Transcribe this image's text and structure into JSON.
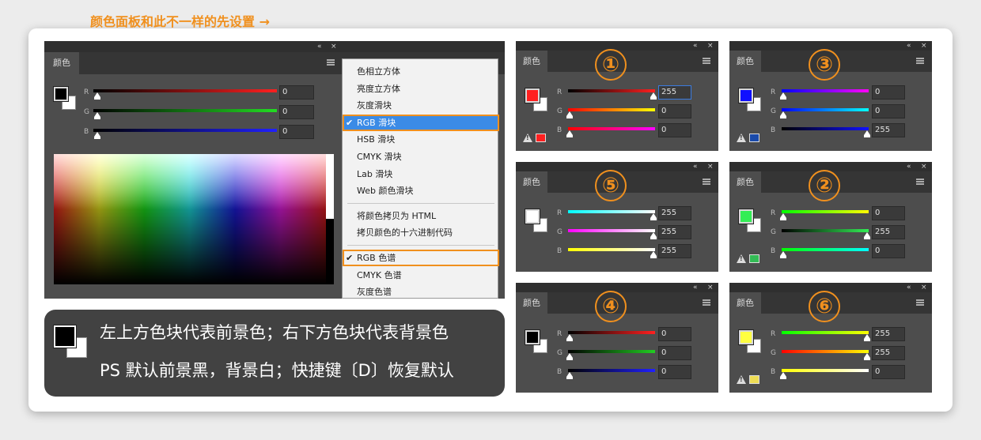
{
  "main_panel": {
    "tab": "颜色",
    "note": "颜色面板和此不一样的先设置 →",
    "collapse": "«",
    "close": "×",
    "fg_color": "#000000",
    "bg_color": "#ffffff",
    "channels": [
      {
        "label": "R",
        "value": "0"
      },
      {
        "label": "G",
        "value": "0"
      },
      {
        "label": "B",
        "value": "0"
      }
    ]
  },
  "menu": {
    "groups": [
      [
        "色相立方体",
        "亮度立方体",
        "灰度滑块",
        "RGB 滑块",
        "HSB 滑块",
        "CMYK 滑块",
        "Lab 滑块",
        "Web 颜色滑块"
      ],
      [
        "将颜色拷贝为 HTML",
        "拷贝颜色的十六进制代码"
      ],
      [
        "RGB 色谱",
        "CMYK 色谱",
        "灰度色谱"
      ]
    ],
    "checked": [
      "RGB 滑块",
      "RGB 色谱"
    ],
    "check_mark": "✔"
  },
  "info": {
    "line1": "左上方色块代表前景色；右下方色块代表背景色",
    "line2": "PS 默认前景黑，背景白；快捷键〔D〕恢复默认"
  },
  "examples": [
    {
      "num": "①",
      "tab": "颜色",
      "fg": "#ff2020",
      "r": "255",
      "g": "0",
      "b": "0",
      "warn": true,
      "gamut": "#ff2020",
      "tracks": [
        "linear-gradient(to right,#000,#ff2020)",
        "linear-gradient(to right,#ff0000,#ffff00)",
        "linear-gradient(to right,#ff0000,#ff00ff)"
      ],
      "thumbs": [
        1,
        0,
        0
      ]
    },
    {
      "num": "②",
      "tab": "颜色",
      "fg": "#33ee55",
      "r": "0",
      "g": "255",
      "b": "0",
      "warn": true,
      "gamut": "#33bb55",
      "tracks": [
        "linear-gradient(to right,#00ff00,#ffff00)",
        "linear-gradient(to right,#000,#33ee55)",
        "linear-gradient(to right,#00ff00,#00ffff)"
      ],
      "thumbs": [
        0,
        1,
        0
      ]
    },
    {
      "num": "③",
      "tab": "颜色",
      "fg": "#1010ff",
      "r": "0",
      "g": "0",
      "b": "255",
      "warn": true,
      "gamut": "#1a4aaa",
      "tracks": [
        "linear-gradient(to right,#0000ff,#ff00ff)",
        "linear-gradient(to right,#0000ff,#00ffff)",
        "linear-gradient(to right,#000,#1010ff)"
      ],
      "thumbs": [
        0,
        0,
        1
      ]
    },
    {
      "num": "④",
      "tab": "颜色",
      "fg": "#000000",
      "r": "0",
      "g": "0",
      "b": "0",
      "warn": false,
      "gamut": "",
      "tracks": [
        "linear-gradient(to right,#000,#ff2020)",
        "linear-gradient(to right,#000,#22cc22)",
        "linear-gradient(to right,#000,#2020ff)"
      ],
      "thumbs": [
        0,
        0,
        0
      ]
    },
    {
      "num": "⑤",
      "tab": "颜色",
      "fg": "#ffffff",
      "r": "255",
      "g": "255",
      "b": "255",
      "warn": false,
      "gamut": "",
      "tracks": [
        "linear-gradient(to right,#00ffff,#fff)",
        "linear-gradient(to right,#ff00ff,#fff)",
        "linear-gradient(to right,#ffff00,#fff)"
      ],
      "thumbs": [
        1,
        1,
        1
      ]
    },
    {
      "num": "⑥",
      "tab": "颜色",
      "fg": "#ffff40",
      "r": "255",
      "g": "255",
      "b": "0",
      "warn": true,
      "gamut": "#eedd55",
      "tracks": [
        "linear-gradient(to right,#00ff00,#ffff00)",
        "linear-gradient(to right,#ff0000,#ffff00)",
        "linear-gradient(to right,#ffff00,#fff)"
      ],
      "thumbs": [
        1,
        1,
        0
      ]
    }
  ],
  "colors": {
    "accent": "#f0901e",
    "panel": "#4d4d4d",
    "menu_highlight": "#3b8be6"
  }
}
